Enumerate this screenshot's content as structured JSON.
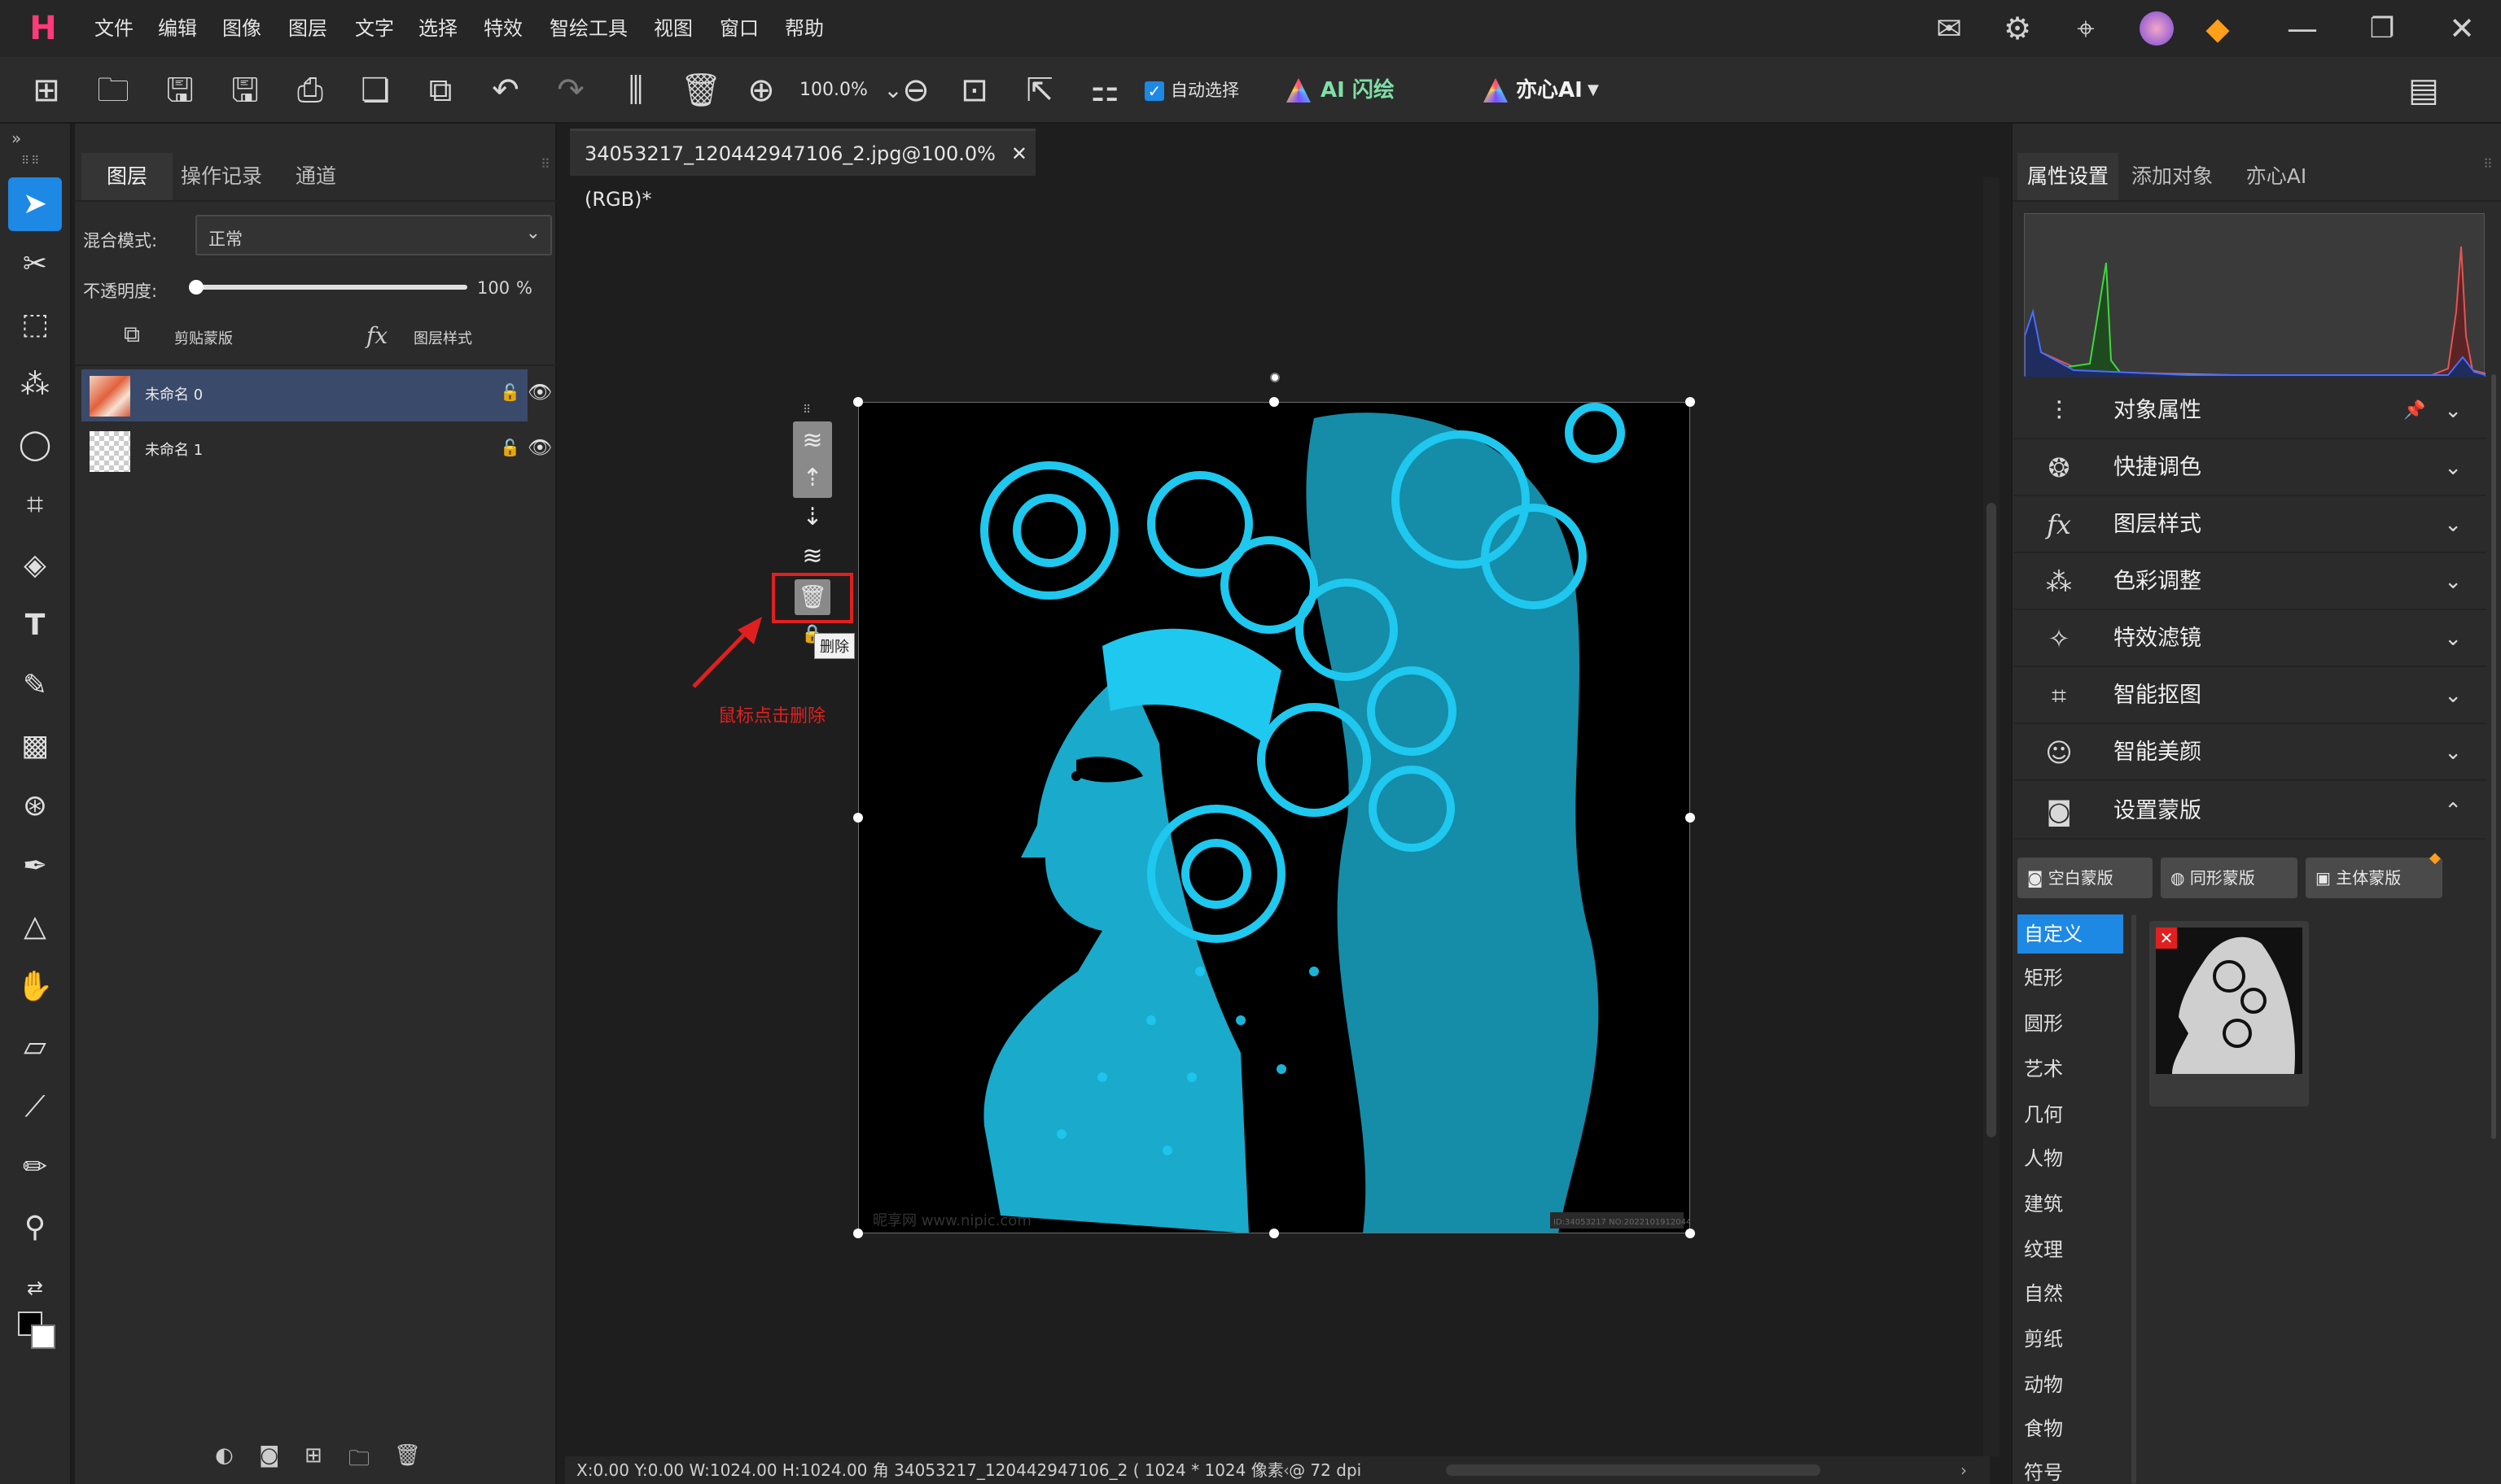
{
  "app": {
    "logo_glyph": "H",
    "menu": [
      "文件",
      "编辑",
      "图像",
      "图层",
      "文字",
      "选择",
      "特效",
      "智绘工具",
      "视图",
      "窗口",
      "帮助"
    ],
    "window_icons": [
      "mail-icon",
      "settings-icon",
      "compass-icon",
      "avatar",
      "gem-icon",
      "minimize-icon",
      "restore-icon",
      "close-icon"
    ]
  },
  "toolbar": {
    "zoom_value": "100.0%",
    "auto_select_label": "自动选择",
    "auto_select_checked": true,
    "ai_flash_label": "AI 闪绘",
    "yixin_ai_label": "亦心AI"
  },
  "layers_panel": {
    "tabs": [
      "图层",
      "操作记录",
      "通道"
    ],
    "active_tab": "图层",
    "blend_mode_label": "混合模式:",
    "blend_mode_value": "正常",
    "opacity_label": "不透明度:",
    "opacity_value": "100",
    "opacity_unit": "%",
    "opacity_fraction": 1.0,
    "clip_mask_label": "剪贴蒙版",
    "fx_glyph": "fx",
    "layer_style_label": "图层样式",
    "layers": [
      {
        "name": "未命名 0",
        "selected": true
      },
      {
        "name": "未命名 1",
        "selected": false
      }
    ]
  },
  "document": {
    "tab_title": "34053217_120442947106_2.jpg@100.0% (RGB)*",
    "tooltip_delete": "删除",
    "annotation_text": "鼠标点击删除",
    "watermark_text": "昵享网 www.nipic.com",
    "image_code_text": "ID:34053217 NO:20221019120442947106",
    "status_text": "X:0.00 Y:0.00 W:1024.00 H:1024.00 角  34053217_120442947106_2 ( 1024 * 1024 像素 @ 72 dpi"
  },
  "right_panel": {
    "tabs": [
      "属性设置",
      "添加对象",
      "亦心AI"
    ],
    "active_tab": "属性设置",
    "sections": [
      {
        "label": "对象属性",
        "icon": "sliders-icon",
        "expanded": false
      },
      {
        "label": "快捷调色",
        "icon": "palette-icon",
        "expanded": false
      },
      {
        "label": "图层样式",
        "icon": "fx-icon",
        "expanded": false
      },
      {
        "label": "色彩调整",
        "icon": "magic-wand-icon",
        "expanded": false
      },
      {
        "label": "特效滤镜",
        "icon": "sparkle-icon",
        "expanded": false
      },
      {
        "label": "智能抠图",
        "icon": "cutout-icon",
        "expanded": false
      },
      {
        "label": "智能美颜",
        "icon": "face-icon",
        "expanded": false
      },
      {
        "label": "设置蒙版",
        "icon": "mask-icon",
        "expanded": true
      }
    ],
    "mask_buttons": [
      "空白蒙版",
      "同形蒙版",
      "主体蒙版"
    ],
    "mask_categories": [
      "自定义",
      "矩形",
      "圆形",
      "艺术",
      "几何",
      "人物",
      "建筑",
      "纹理",
      "自然",
      "剪纸",
      "动物",
      "食物",
      "符号"
    ],
    "active_category": "自定义"
  },
  "colors": {
    "accent_blue": "#1e88e5",
    "selection_blue": "#3a4a6b",
    "figure_cyan": "#1ec8ef",
    "annotation_red": "#e02020"
  }
}
